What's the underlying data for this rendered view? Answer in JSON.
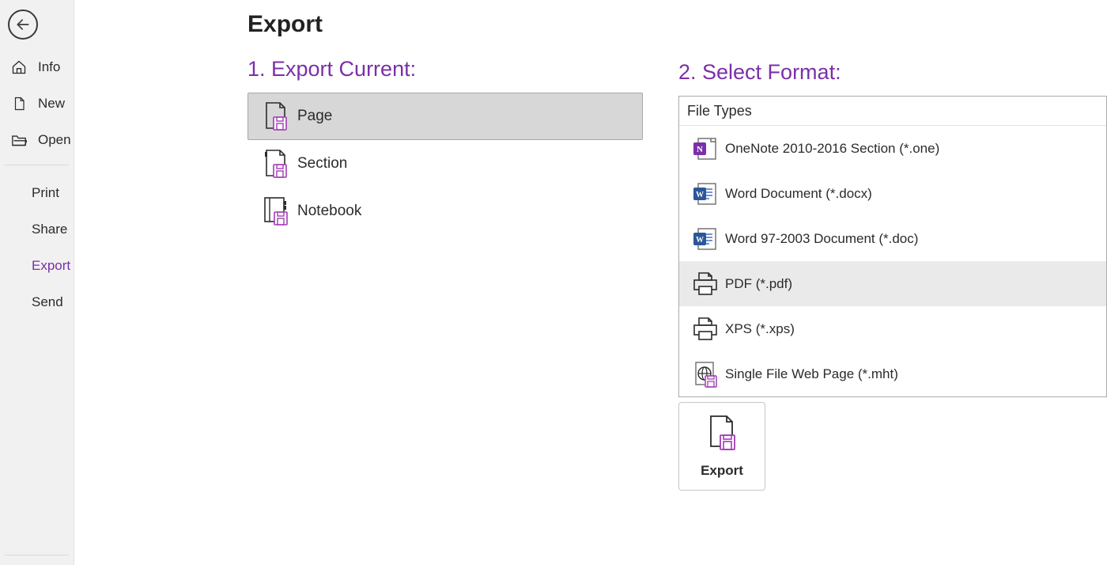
{
  "accent": "#7b2fa8",
  "sidebar": {
    "items": [
      {
        "label": "Info",
        "icon": "home-icon",
        "active": false
      },
      {
        "label": "New",
        "icon": "page-icon",
        "active": false
      },
      {
        "label": "Open",
        "icon": "folder-icon",
        "active": false
      },
      {
        "label": "Print",
        "icon": null,
        "active": false
      },
      {
        "label": "Share",
        "icon": null,
        "active": false
      },
      {
        "label": "Export",
        "icon": null,
        "active": true
      },
      {
        "label": "Send",
        "icon": null,
        "active": false
      }
    ]
  },
  "page": {
    "title": "Export"
  },
  "step1": {
    "heading": "1. Export Current:",
    "options": [
      {
        "label": "Page",
        "selected": true
      },
      {
        "label": "Section",
        "selected": false
      },
      {
        "label": "Notebook",
        "selected": false
      }
    ]
  },
  "step2": {
    "heading": "2. Select Format:",
    "group_header": "File Types",
    "options": [
      {
        "label": "OneNote 2010-2016 Section (*.one)",
        "icon": "onenote-icon",
        "selected": false
      },
      {
        "label": "Word Document (*.docx)",
        "icon": "word-icon",
        "selected": false
      },
      {
        "label": "Word 97-2003 Document (*.doc)",
        "icon": "word-icon",
        "selected": false
      },
      {
        "label": "PDF (*.pdf)",
        "icon": "printer-icon",
        "selected": true
      },
      {
        "label": "XPS (*.xps)",
        "icon": "printer-icon",
        "selected": false
      },
      {
        "label": "Single File Web Page (*.mht)",
        "icon": "web-page-icon",
        "selected": false
      }
    ]
  },
  "export_button": {
    "label": "Export"
  }
}
